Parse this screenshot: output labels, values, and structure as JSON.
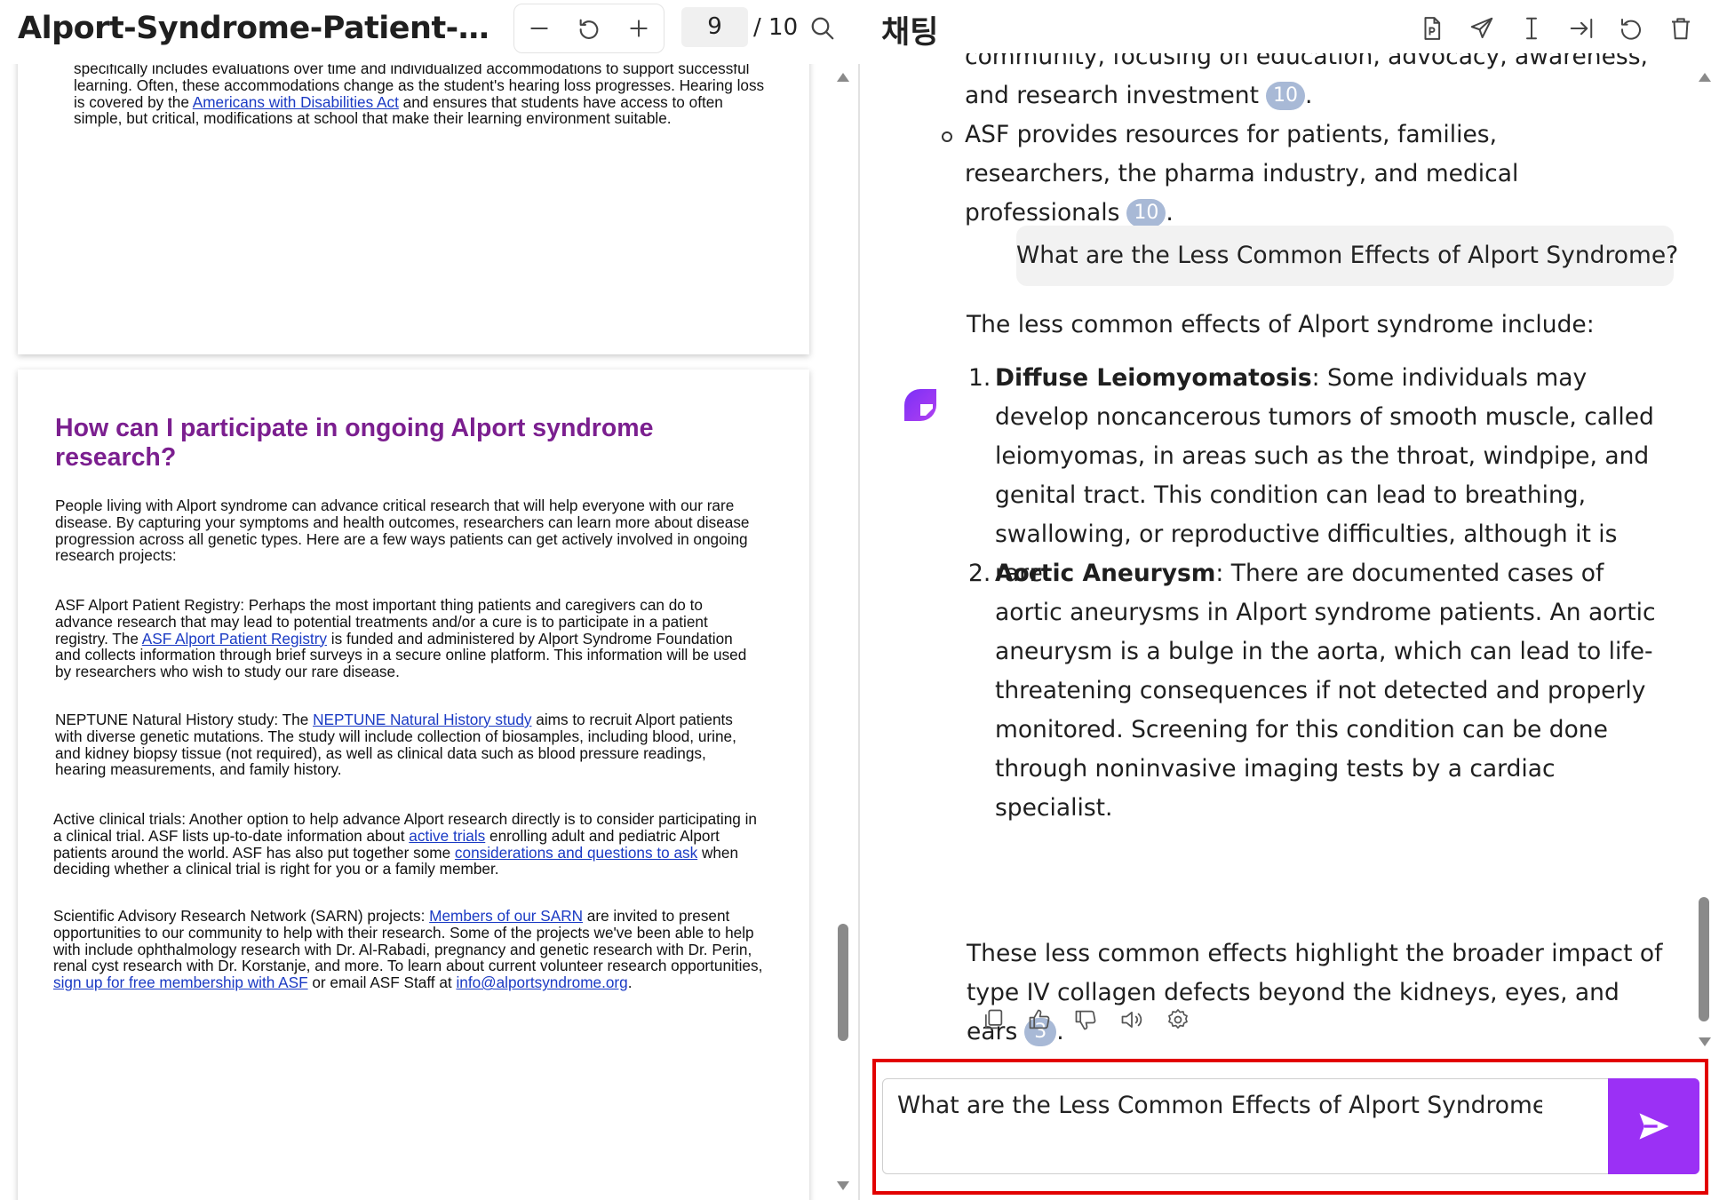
{
  "pdf_viewer": {
    "document_title": "Alport-Syndrome-Patient-Guide...",
    "current_page": "9",
    "total_pages": "/ 10",
    "page1": {
      "paragraph": [
        {
          "t": "specifically includes evaluations over time and individualized accommodations to support successful learning. Often, these accommodations change as the student's hearing loss progresses. Hearing loss is covered by the "
        },
        {
          "t": "Americans with Disabilities Act",
          "link": true
        },
        {
          "t": " and ensures that students have access to often simple, but critical, modifications at school that make their learning environment suitable."
        }
      ]
    },
    "page2": {
      "heading": "How can I participate in ongoing Alport syndrome research?",
      "paragraphs": [
        [
          {
            "t": "People living with Alport syndrome can advance critical research that will help everyone with our rare disease. By capturing your symptoms and health outcomes, researchers can learn more about disease progression across all genetic types. Here are a few ways patients can get actively involved in ongoing research projects:"
          }
        ],
        [
          {
            "t": "ASF Alport Patient Registry: Perhaps the most important thing patients and caregivers can do to advance research that may lead to potential treatments and/or a cure is to participate in a patient registry. The "
          },
          {
            "t": "ASF Alport Patient Registry",
            "link": true
          },
          {
            "t": " is funded and administered by Alport Syndrome Foundation and collects information through brief surveys in a secure online platform. This information will be used by researchers who wish to study our rare disease."
          }
        ],
        [
          {
            "t": "NEPTUNE Natural History study: The "
          },
          {
            "t": "NEPTUNE Natural History study",
            "link": true
          },
          {
            "t": " aims to recruit Alport patients with diverse genetic mutations. The study will include collection of biosamples, including blood, urine, and kidney biopsy tissue (not required), as well as clinical data such as blood pressure readings, hearing measurements, and family history."
          }
        ],
        [
          {
            "t": "Active clinical trials: Another option to help advance Alport research directly is to consider participating in a clinical trial. ASF lists up-to-date information about "
          },
          {
            "t": "active trials",
            "link": true
          },
          {
            "t": " enrolling adult and pediatric Alport patients around the world. ASF has also put together some "
          },
          {
            "t": "considerations and questions to ask",
            "link": true
          },
          {
            "t": " when deciding whether a clinical trial is right for you or a family member."
          }
        ],
        [
          {
            "t": "Scientific Advisory Research Network (SARN) projects: "
          },
          {
            "t": "Members of our SARN",
            "link": true
          },
          {
            "t": " are invited to present opportunities to our community to help with their research. Some of the projects we've been able to help with include ophthalmology research with Dr. Al-Rabadi, pregnancy and genetic research with Dr. Perin, renal cyst research with Dr. Korstanje, and more. To learn about current volunteer research opportunities, "
          },
          {
            "t": "sign up for free membership with ASF",
            "link": true
          },
          {
            "t": " or email ASF Staff at "
          },
          {
            "t": "info@alportsyndrome.org",
            "link": true
          },
          {
            "t": "."
          }
        ]
      ]
    }
  },
  "chat": {
    "title": "채팅",
    "previous_answer": {
      "partial_line": "community, focusing on education, advocacy, awareness,",
      "bullet1_text": "and research investment",
      "bullet1_cite": "10",
      "bullet2_text": "ASF provides resources for patients, families, researchers, the pharma industry, and medical professionals",
      "bullet2_cite": "10"
    },
    "user_question": "What are the Less Common Effects of Alport Syndrome?",
    "answer": {
      "intro": "The less common effects of Alport syndrome include:",
      "items": [
        {
          "num": "1.",
          "term": "Diffuse Leiomyomatosis",
          "text": ": Some individuals may develop noncancerous tumors of smooth muscle, called leiomyomas, in areas such as the throat, windpipe, and genital tract. This condition can lead to breathing, swallowing, or reproductive difficulties, although it is rare."
        },
        {
          "num": "2.",
          "term": "Aortic Aneurysm",
          "text": ": There are documented cases of aortic aneurysms in Alport syndrome patients. An aortic aneurysm is a bulge in the aorta, which can lead to life-threatening consequences if not detected and properly monitored. Screening for this condition can be done through noninvasive imaging tests by a cardiac specialist."
        }
      ],
      "outro": "These less common effects highlight the broader impact of type IV collagen defects beyond the kidneys, eyes, and ears",
      "outro_cite": "3"
    },
    "composer": {
      "value": "What are the Less Common Effects of Alport Syndrome?"
    }
  },
  "colors": {
    "accent_purple": "#9b30f5",
    "heading_purple": "#7b1f8f",
    "link_blue": "#1a3ac4",
    "cite_badge": "#a8b9d6",
    "highlight_red": "#e20000"
  },
  "icons": [
    "zoom-out-icon",
    "reset-zoom-icon",
    "zoom-in-icon",
    "search-icon",
    "pdf-export-icon",
    "send-plane-icon",
    "text-cursor-icon",
    "exit-icon",
    "refresh-icon",
    "trash-icon",
    "bot-avatar-icon",
    "copy-icon",
    "thumbs-up-icon",
    "thumbs-down-icon",
    "speaker-icon",
    "settings-icon",
    "send-arrow-icon"
  ]
}
